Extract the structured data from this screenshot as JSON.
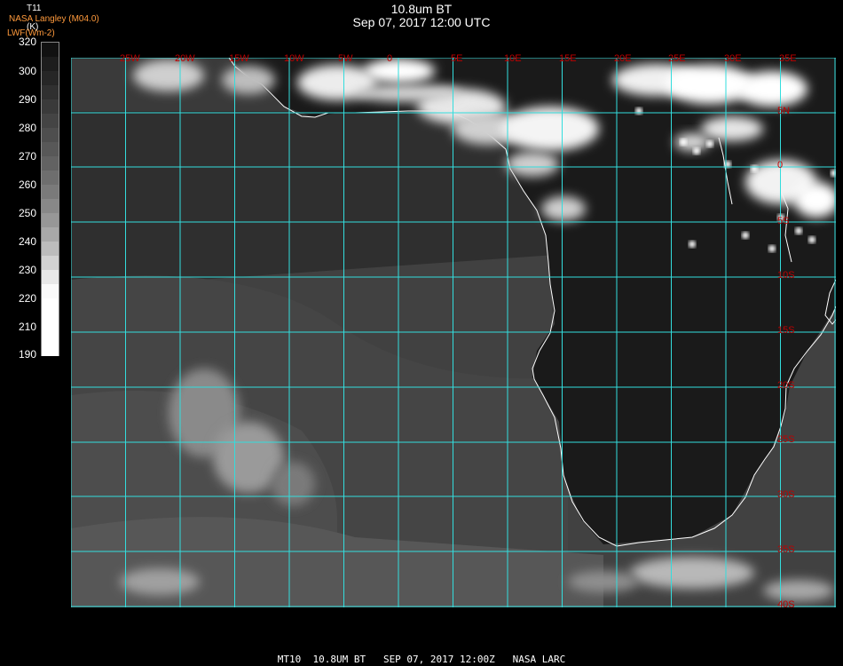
{
  "header": {
    "title": "10.8um BT",
    "datetime": "Sep 07, 2017 12:00 UTC",
    "source": "NASA Langley (M04.0)",
    "product": "LWF(Wm-2)"
  },
  "legend": {
    "variable": "T11",
    "unit": "(K)",
    "ticks": [
      "320",
      "300",
      "290",
      "280",
      "270",
      "260",
      "250",
      "240",
      "230",
      "220",
      "210",
      "190"
    ]
  },
  "grid": {
    "color": "#33dddd",
    "lon_labels": [
      "25W",
      "20W",
      "15W",
      "10W",
      "5W",
      "0",
      "5E",
      "10E",
      "15E",
      "20E",
      "25E",
      "30E",
      "35E"
    ],
    "lat_labels": [
      "5N",
      "0",
      "5S",
      "10S",
      "15S",
      "20S",
      "25S",
      "30S",
      "35S",
      "40S"
    ]
  },
  "footer": "MT10  10.8UM BT   SEP 07, 2017 12:00Z   NASA LARC"
}
